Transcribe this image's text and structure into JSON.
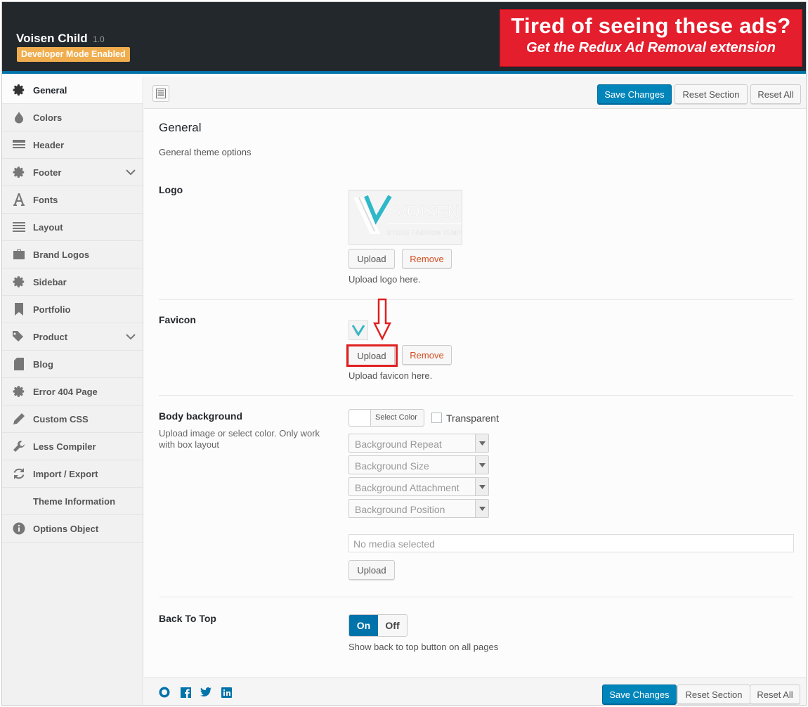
{
  "header": {
    "app_title": "Voisen Child",
    "version": "1.0",
    "dev_badge": "Developer Mode Enabled",
    "ad_line1": "Tired of seeing these ads?",
    "ad_line2": "Get the Redux Ad Removal extension"
  },
  "sidebar": {
    "items": [
      {
        "label": "General",
        "icon": "gear-icon",
        "active": true
      },
      {
        "label": "Colors",
        "icon": "droplet-icon"
      },
      {
        "label": "Header",
        "icon": "header-icon"
      },
      {
        "label": "Footer",
        "icon": "gear-icon",
        "has_children": true
      },
      {
        "label": "Fonts",
        "icon": "font-icon"
      },
      {
        "label": "Layout",
        "icon": "list-icon"
      },
      {
        "label": "Brand Logos",
        "icon": "briefcase-icon"
      },
      {
        "label": "Sidebar",
        "icon": "gear-icon"
      },
      {
        "label": "Portfolio",
        "icon": "bookmark-icon"
      },
      {
        "label": "Product",
        "icon": "tags-icon",
        "has_children": true
      },
      {
        "label": "Blog",
        "icon": "document-icon"
      },
      {
        "label": "Error 404 Page",
        "icon": "gear-icon"
      },
      {
        "label": "Custom CSS",
        "icon": "pencil-icon"
      },
      {
        "label": "Less Compiler",
        "icon": "wrench-icon"
      },
      {
        "label": "Import / Export",
        "icon": "refresh-icon"
      },
      {
        "label": "Theme Information",
        "icon": ""
      },
      {
        "label": "Options Object",
        "icon": "info-icon"
      }
    ]
  },
  "toolbar": {
    "save": "Save Changes",
    "reset_section": "Reset Section",
    "reset_all": "Reset All"
  },
  "section": {
    "title": "General",
    "description": "General theme options"
  },
  "logo": {
    "label": "Logo",
    "brand_text": "VOISEN",
    "brand_sub": "STORE FASHION TEMPLA",
    "upload": "Upload",
    "remove": "Remove",
    "help": "Upload logo here."
  },
  "favicon": {
    "label": "Favicon",
    "upload": "Upload",
    "remove": "Remove",
    "help": "Upload favicon here."
  },
  "body_background": {
    "label": "Body background",
    "sub": "Upload image or select color. Only work with box layout",
    "select_color": "Select Color",
    "transparent": "Transparent",
    "repeat_placeholder": "Background Repeat",
    "size_placeholder": "Background Size",
    "attachment_placeholder": "Background Attachment",
    "position_placeholder": "Background Position",
    "media_placeholder": "No media selected",
    "upload": "Upload"
  },
  "back_to_top": {
    "label": "Back To Top",
    "on": "On",
    "off": "Off",
    "help": "Show back to top button on all pages"
  },
  "footer": {
    "save": "Save Changes",
    "reset_section": "Reset Section",
    "reset_all": "Reset All"
  },
  "colors": {
    "accent": "#0085ba",
    "header_bg": "#23282d",
    "badge": "#f0ad4e",
    "ad_bg": "#e41e2d",
    "remove_text": "#d54e21",
    "highlight": "#e02020"
  }
}
